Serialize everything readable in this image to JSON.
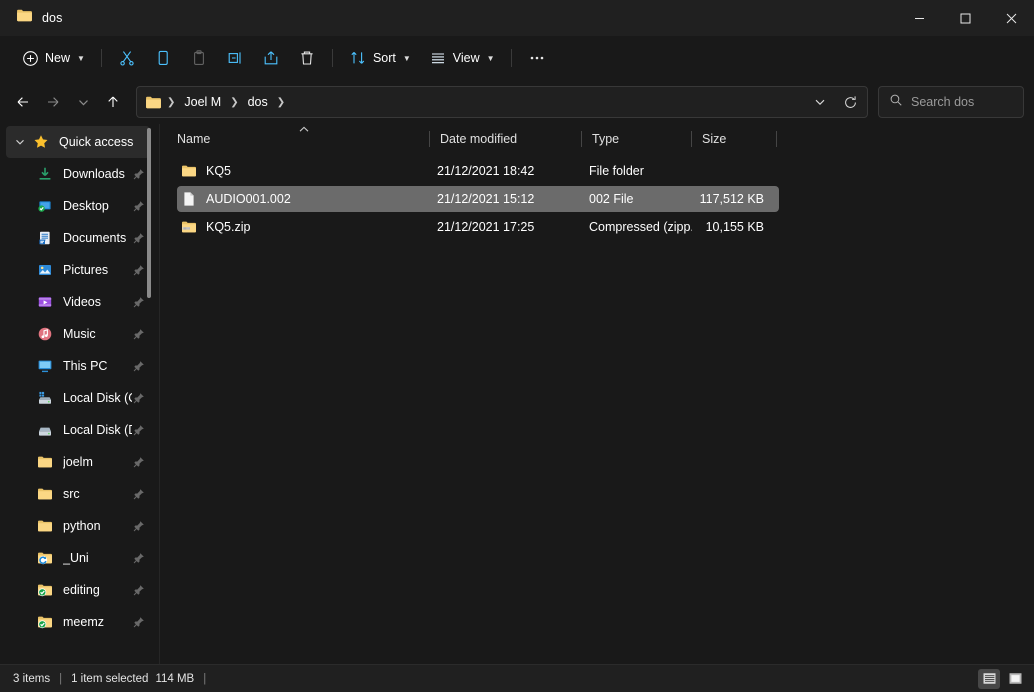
{
  "window": {
    "tab_title": "dos",
    "minimize_label": "Minimize",
    "maximize_label": "Maximize",
    "close_label": "Close"
  },
  "toolbar": {
    "new_label": "New",
    "cut_label": "Cut",
    "copy_label": "Copy",
    "paste_label": "Paste",
    "rename_label": "Rename",
    "share_label": "Share",
    "delete_label": "Delete",
    "sort_label": "Sort",
    "view_label": "View",
    "more_label": "See more"
  },
  "addressbar": {
    "back_label": "Back",
    "forward_label": "Forward",
    "recent_label": "Recent locations",
    "up_label": "Up to Joel M",
    "crumbs": [
      {
        "label": "Joel M"
      },
      {
        "label": "dos"
      }
    ],
    "dropdown_label": "Previous locations",
    "refresh_label": "Refresh"
  },
  "search": {
    "placeholder": "Search dos",
    "value": ""
  },
  "sidebar": {
    "items": [
      {
        "label": "Quick access",
        "icon": "star-icon",
        "type": "header",
        "pinned": false
      },
      {
        "label": "Downloads",
        "icon": "downloads-icon",
        "type": "child",
        "pinned": true
      },
      {
        "label": "Desktop",
        "icon": "desktop-icon",
        "type": "child",
        "pinned": true
      },
      {
        "label": "Documents",
        "icon": "documents-icon",
        "type": "child",
        "pinned": true
      },
      {
        "label": "Pictures",
        "icon": "pictures-icon",
        "type": "child",
        "pinned": true
      },
      {
        "label": "Videos",
        "icon": "videos-icon",
        "type": "child",
        "pinned": true
      },
      {
        "label": "Music",
        "icon": "music-icon",
        "type": "child",
        "pinned": true
      },
      {
        "label": "This PC",
        "icon": "this-pc-icon",
        "type": "child",
        "pinned": true
      },
      {
        "label": "Local Disk (C:)",
        "icon": "system-drive-icon",
        "type": "child",
        "pinned": true
      },
      {
        "label": "Local Disk (D:)",
        "icon": "drive-icon",
        "type": "child",
        "pinned": true
      },
      {
        "label": "joelm",
        "icon": "folder-icon",
        "type": "child",
        "pinned": true
      },
      {
        "label": "src",
        "icon": "folder-icon",
        "type": "child",
        "pinned": true
      },
      {
        "label": "python",
        "icon": "folder-icon",
        "type": "child",
        "pinned": true
      },
      {
        "label": "_Uni",
        "icon": "folder-sync-icon",
        "type": "child",
        "pinned": true
      },
      {
        "label": "editing",
        "icon": "folder-synced-icon",
        "type": "child",
        "pinned": true
      },
      {
        "label": "meemz",
        "icon": "folder-synced-icon",
        "type": "child",
        "pinned": true
      }
    ]
  },
  "filelist": {
    "columns": [
      {
        "key": "name",
        "label": "Name",
        "sorted": "asc"
      },
      {
        "key": "date",
        "label": "Date modified",
        "sorted": ""
      },
      {
        "key": "type",
        "label": "Type",
        "sorted": ""
      },
      {
        "key": "size",
        "label": "Size",
        "sorted": ""
      }
    ],
    "rows": [
      {
        "name": "KQ5",
        "date": "21/12/2021 18:42",
        "type": "File folder",
        "size": "",
        "icon": "folder-icon",
        "selected": false
      },
      {
        "name": "AUDIO001.002",
        "date": "21/12/2021 15:12",
        "type": "002 File",
        "size": "117,512 KB",
        "icon": "generic-file-icon",
        "selected": true
      },
      {
        "name": "KQ5.zip",
        "date": "21/12/2021 17:25",
        "type": "Compressed (zipp...",
        "size": "10,155 KB",
        "icon": "zip-folder-icon",
        "selected": false
      }
    ]
  },
  "statusbar": {
    "item_count": "3 items",
    "selection_text": "1 item selected",
    "selection_size": "114 MB",
    "details_view_label": "Details view",
    "large_icons_view_label": "Large icons view"
  },
  "colors": {
    "window_bg": "#191919",
    "chrome_bg": "#202020",
    "selection": "#6b6b6b",
    "accent_blue": "#4cc2ff",
    "folder_yellow": "#f2c24f"
  }
}
